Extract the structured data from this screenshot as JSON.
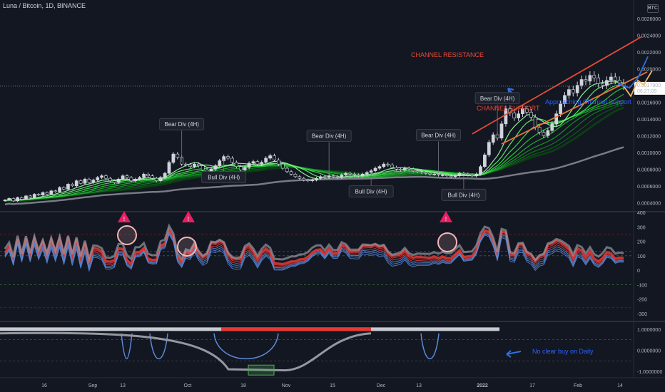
{
  "header": {
    "title": "Luna / Bitcoin, 1D, BINANCE",
    "currency": "BTC"
  },
  "price_tag": {
    "price": "0.0017900",
    "countdown": "06:27:09"
  },
  "chart_data": [
    {
      "type": "candlestick",
      "panel": "price",
      "yticks": [
        "0.0026000",
        "0.0024000",
        "0.0022000",
        "0.0020000",
        "0.0018000",
        "0.0016000",
        "0.0014000",
        "0.0012000",
        "0.0010000",
        "0.0008000",
        "0.0006000",
        "0.0004000"
      ],
      "ylim": [
        0.0003,
        0.0027
      ],
      "close": [
        0.00043,
        0.00045,
        0.00042,
        0.00046,
        0.00044,
        0.00048,
        0.00046,
        0.0005,
        0.00049,
        0.00052,
        0.0005,
        0.00054,
        0.00053,
        0.00058,
        0.00056,
        0.00062,
        0.0006,
        0.00066,
        0.00063,
        0.00068,
        0.00064,
        0.00067,
        0.0007,
        0.00072,
        0.00069,
        0.00066,
        0.00064,
        0.00068,
        0.00072,
        0.0007,
        0.00066,
        0.00068,
        0.0007,
        0.00074,
        0.00072,
        0.00069,
        0.00066,
        0.0007,
        0.00075,
        0.00088,
        0.00098,
        0.00094,
        0.00086,
        0.00085,
        0.00083,
        0.00086,
        0.00084,
        0.00079,
        0.00076,
        0.0008,
        0.00084,
        0.0009,
        0.00095,
        0.00093,
        0.00088,
        0.00083,
        0.00079,
        0.00082,
        0.00087,
        0.00089,
        0.00086,
        0.00088,
        0.00093,
        0.00096,
        0.00091,
        0.00086,
        0.00081,
        0.00077,
        0.00074,
        0.00071,
        0.00069,
        0.00067,
        0.00066,
        0.00067,
        0.00069,
        0.00071,
        0.0007,
        0.00072,
        0.00071,
        0.0007,
        0.00073,
        0.00075,
        0.00074,
        0.00073,
        0.00072,
        0.00074,
        0.00076,
        0.00078,
        0.00081,
        0.00083,
        0.00086,
        0.00085,
        0.00082,
        0.0008,
        0.00079,
        0.00081,
        0.0008,
        0.00078,
        0.00077,
        0.00076,
        0.00075,
        0.00074,
        0.00074,
        0.00073,
        0.00073,
        0.00072,
        0.00071,
        0.00072,
        0.00075,
        0.00074,
        0.00073,
        0.00072,
        0.00074,
        0.00083,
        0.00097,
        0.00112,
        0.00121,
        0.00117,
        0.00134,
        0.00152,
        0.00147,
        0.00141,
        0.00146,
        0.00152,
        0.00148,
        0.00142,
        0.0013,
        0.00124,
        0.0012,
        0.00126,
        0.00134,
        0.00146,
        0.00158,
        0.00168,
        0.00175,
        0.00171,
        0.0018,
        0.00187,
        0.00185,
        0.00192,
        0.00189,
        0.00182,
        0.0018,
        0.00186,
        0.0019,
        0.00186,
        0.00183,
        0.00179
      ],
      "annotations": [
        {
          "text": "Bear Div (4H)",
          "at": 42
        },
        {
          "text": "Bear Div (4H)",
          "at": 77
        },
        {
          "text": "Bear Div (4H)",
          "at": 103
        },
        {
          "text": "Bear Div (4H)",
          "at": 117
        },
        {
          "text": "Bull Div (4H)",
          "at": 52
        },
        {
          "text": "Bull Div (4H)",
          "at": 87
        },
        {
          "text": "Bull Div (4H)",
          "at": 109
        }
      ],
      "channel_resistance_label": "CHANNEL RESISTANCE",
      "channel_support_label": "CHANNEL SUPPORT",
      "note": "Approaching Channel Support"
    },
    {
      "type": "line",
      "panel": "oscillator",
      "yticks": [
        "400",
        "300",
        "200",
        "100",
        "0",
        "-100",
        "-200",
        "-300"
      ],
      "ylim": [
        -350,
        400
      ],
      "note": ""
    },
    {
      "type": "line",
      "panel": "signal",
      "yticks": [
        "1.0000000",
        "0.0000000",
        "-1.0000000"
      ],
      "ylim": [
        -1.3,
        1.3
      ],
      "note": "No clear buy on Daily"
    }
  ],
  "xaxis": {
    "labels": [
      "16",
      "Sep",
      "13",
      "Oct",
      "18",
      "Nov",
      "15",
      "Dec",
      "13",
      "2022",
      "17",
      "Feb",
      "14"
    ]
  },
  "colors": {
    "bg": "#131722",
    "up": "#d1d4dc",
    "down": "#131722",
    "ribbon": "#1f9d2f",
    "bear_red": "#e53935",
    "blue": "#2962ff",
    "orange": "#ff9800"
  }
}
